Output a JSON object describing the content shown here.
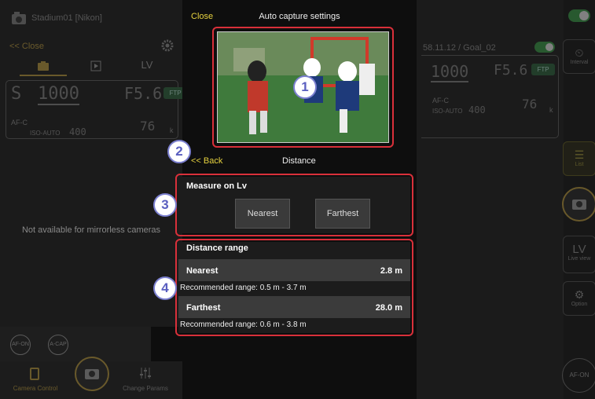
{
  "left": {
    "title": "Stadium01 [Nikon]",
    "close": "<< Close",
    "tab_lv": "LV",
    "lcd": {
      "mode": "S",
      "shutter": "1000",
      "fnum": "F5.6",
      "badge": "FTP",
      "af": "AF-C",
      "iso": "ISO-AUTO",
      "iso_value": "400",
      "shots": "76",
      "k": "k"
    },
    "message": "Not available for mirrorless cameras",
    "af_on": "AF-ON",
    "a_cap": "A-CAP",
    "nav_camera_control": "Camera Control",
    "nav_change_params": "Change Params"
  },
  "dialog": {
    "close": "Close",
    "title": "Auto capture settings",
    "back": "<< Back",
    "subtitle": "Distance",
    "measure": {
      "heading": "Measure on Lv",
      "nearest_btn": "Nearest",
      "farthest_btn": "Farthest"
    },
    "range": {
      "heading": "Distance range",
      "nearest_label": "Nearest",
      "nearest_value": "2.8 m",
      "nearest_rec": "Recommended range: 0.5 m - 3.7 m",
      "farthest_label": "Farthest",
      "farthest_value": "28.0 m",
      "farthest_rec": "Recommended range: 0.6 m - 3.8 m"
    },
    "callouts": [
      "1",
      "2",
      "3",
      "4"
    ]
  },
  "right": {
    "header": "58.11.12 / Goal_02",
    "lcd": {
      "shutter": "1000",
      "fnum": "F5.6",
      "badge": "FTP",
      "af": "AF-C",
      "iso": "ISO-AUTO",
      "iso_value": "400",
      "shots": "76",
      "k": "k"
    },
    "interval": "Interval",
    "list": "List",
    "lv": "LV",
    "live_view": "Live view",
    "option": "Option",
    "af_on": "AF-ON"
  },
  "colors": {
    "accent_yellow": "#e6d23f",
    "callout_border": "#d9303a",
    "toggle_green": "#3aa84a"
  }
}
